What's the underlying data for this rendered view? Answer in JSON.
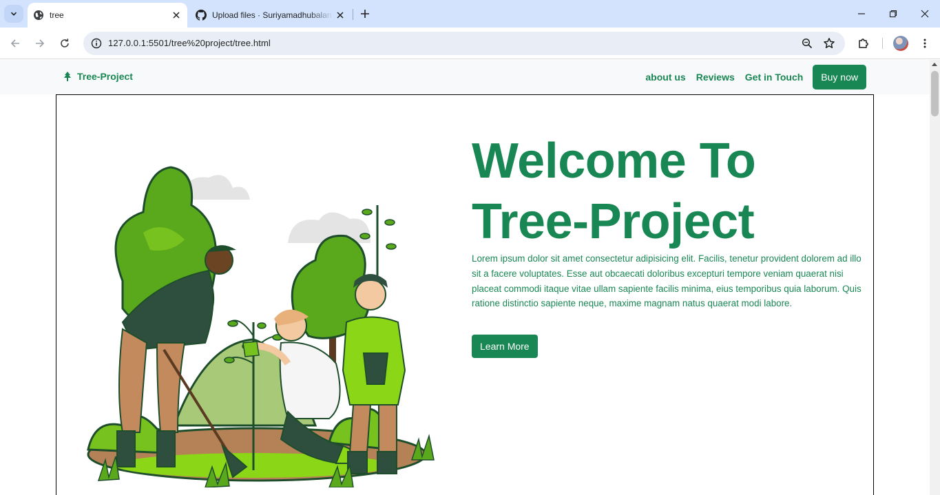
{
  "browser": {
    "tabs": [
      {
        "title": "tree",
        "icon": "globe-icon",
        "active": true
      },
      {
        "title": "Upload files · Suriyamadhubalan",
        "icon": "github-icon",
        "active": false
      }
    ],
    "url": "127.0.0.1:5501/tree%20project/tree.html"
  },
  "navbar": {
    "brand": "Tree-Project",
    "brand_icon": "tree-icon",
    "links": [
      "about us",
      "Reviews",
      "Get in Touch"
    ],
    "cta": "Buy now"
  },
  "hero": {
    "title_line1": "Welcome To",
    "title_line2": "Tree-Project",
    "body": "Lorem ipsum dolor sit amet consectetur adipisicing elit. Facilis, tenetur provident dolorem ad illo sit a facere voluptates. Esse aut obcaecati doloribus excepturi tempore veniam quaerat nisi placeat commodi itaque vitae ullam sapiente facilis minima, eius temporibus quia laborum. Quis ratione distinctio sapiente neque, maxime magnam natus quaerat modi labore.",
    "button": "Learn More",
    "illustration": "people-planting-trees-illustration"
  },
  "colors": {
    "brand_green": "#198754",
    "tabstrip": "#d3e3fd",
    "navbar_bg": "#f8f9fa"
  }
}
